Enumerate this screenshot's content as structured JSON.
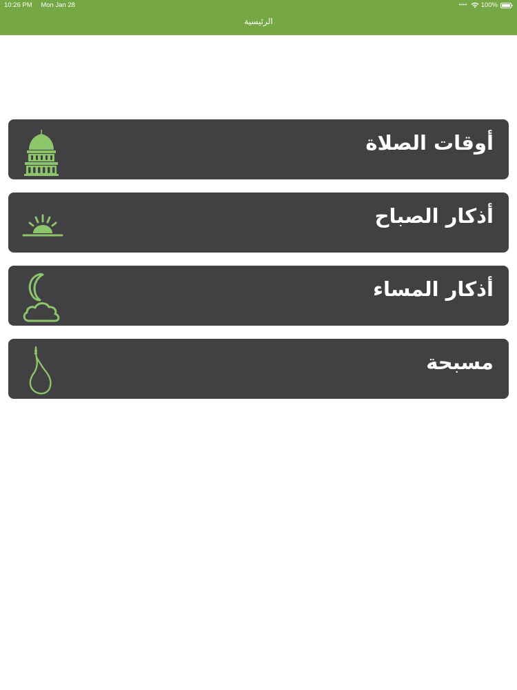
{
  "status_bar": {
    "time": "10:26 PM",
    "date": "Mon Jan 28",
    "battery": "100%"
  },
  "nav": {
    "title": "الرئيسية"
  },
  "colors": {
    "header_bg": "#75a844",
    "card_bg": "#414042",
    "icon_green": "#8dc66a",
    "text_white": "#ffffff"
  },
  "menu": [
    {
      "label": "أوقات الصلاة",
      "icon": "mosque-icon"
    },
    {
      "label": "أذكار الصباح",
      "icon": "sunrise-icon"
    },
    {
      "label": "أذكار المساء",
      "icon": "moon-cloud-icon"
    },
    {
      "label": "مسبحة",
      "icon": "prayer-beads-icon"
    }
  ]
}
